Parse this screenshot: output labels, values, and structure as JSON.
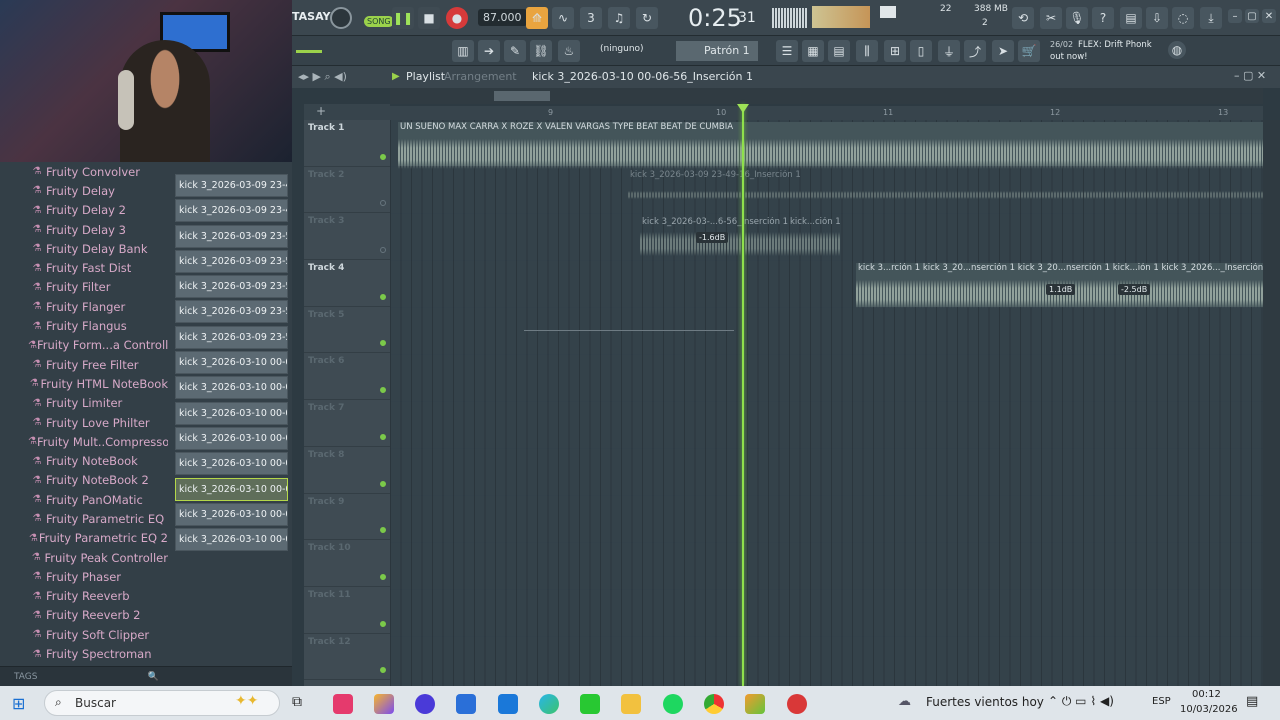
{
  "transport": {
    "song_label": "SONG",
    "tempo": "87.000",
    "time": "0:25",
    "time_sub": "31",
    "cpu": "22",
    "memory": "388 MB",
    "voices": "2",
    "app_title_fragment": "TASAYU"
  },
  "toolbar": {
    "snap": "(ninguno)",
    "pattern": "Patrón 1",
    "news_date": "26/02",
    "news_text": "FLEX: Drift Phonk",
    "news_text2": "out now!"
  },
  "playlist": {
    "title": "Playlist",
    "subtitle": "Arrangement",
    "clip_name": "kick 3_2026-03-10 00-06-56_Inserción 1"
  },
  "ruler": [
    "9",
    "10",
    "11",
    "12",
    "13"
  ],
  "tracks": [
    {
      "name": "Track 1",
      "active": true
    },
    {
      "name": "Track 2",
      "active": false
    },
    {
      "name": "Track 3",
      "active": false
    },
    {
      "name": "Track 4",
      "active": true
    },
    {
      "name": "Track 5",
      "active": false
    },
    {
      "name": "Track 6",
      "active": false
    },
    {
      "name": "Track 7",
      "active": false
    },
    {
      "name": "Track 8",
      "active": false
    },
    {
      "name": "Track 9",
      "active": false
    },
    {
      "name": "Track 10",
      "active": false
    },
    {
      "name": "Track 11",
      "active": false
    },
    {
      "name": "Track 12",
      "active": false
    }
  ],
  "clips": {
    "track1": "UN SUEÑO MAX CARRA X ROZE X VALEN VARGAS TYPE BEAT  BEAT DE CUMBIA",
    "track2": "kick 3_2026-03-09 23-49-16_Inserción 1",
    "track3a": "kick 3_2026-03-...6-56_Inserción 1",
    "track3b": "kick...ción 1",
    "track3_gain": "-1.6dB",
    "track4": "kick 3...rción 1  kick 3_20...nserción 1  kick 3_20...nserción 1  kick...ión 1  kick 3_2026..._Inserción 1",
    "track4_gain1": "1.1dB",
    "track4_gain2": "-2.5dB"
  },
  "plugins": [
    "Fruity Convolver",
    "Fruity Delay",
    "Fruity Delay 2",
    "Fruity Delay 3",
    "Fruity Delay Bank",
    "Fruity Fast Dist",
    "Fruity Filter",
    "Fruity Flanger",
    "Fruity Flangus",
    "Fruity Form...a Controller",
    "Fruity Free Filter",
    "Fruity HTML NoteBook",
    "Fruity Limiter",
    "Fruity Love Philter",
    "Fruity Mult..Compressor",
    "Fruity NoteBook",
    "Fruity NoteBook 2",
    "Fruity PanOMatic",
    "Fruity Parametric EQ",
    "Fruity Parametric EQ 2",
    "Fruity Peak Controller",
    "Fruity Phaser",
    "Fruity Reeverb",
    "Fruity Reeverb 2",
    "Fruity Soft Clipper",
    "Fruity Spectroman"
  ],
  "files": [
    "kick 3_2026-03-09 23-49...",
    "kick 3_2026-03-09 23-49...",
    "kick 3_2026-03-09 23-55...",
    "kick 3_2026-03-09 23-56...",
    "kick 3_2026-03-09 23-57...",
    "kick 3_2026-03-09 23-57...",
    "kick 3_2026-03-09 23-58...",
    "kick 3_2026-03-10 00-00...",
    "kick 3_2026-03-10 00-04...",
    "kick 3_2026-03-10 00-04...",
    "kick 3_2026-03-10 00-05...",
    "kick 3_2026-03-10 00-05...",
    "kick 3_2026-03-10 00-06...",
    "kick 3_2026-03-10 00-07...",
    "kick 3_2026-03-10 00-09..."
  ],
  "selected_file_index": 12,
  "browser": {
    "tags_label": "TAGS"
  },
  "taskbar": {
    "search_placeholder": "Buscar",
    "weather": "Fuertes vientos hoy",
    "lang": "ESP",
    "clock_time": "00:12",
    "clock_date": "10/03/2026"
  }
}
